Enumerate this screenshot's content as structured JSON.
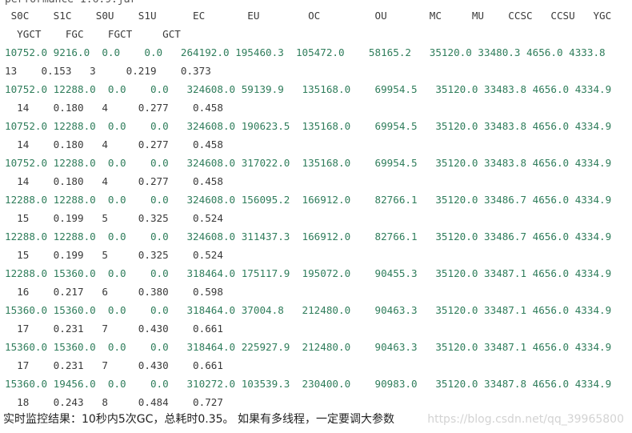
{
  "cmdline": "performance 1.6.9.jar",
  "header_row1": " S0C    S1C    S0U    S1U      EC       EU        OC         OU       MC     MU    CCSC   CCSU   YGC",
  "header_row2": "  YGCT    FGC    FGCT     GCT",
  "rows": [
    {
      "a": "10752.0 9216.0  0.0    0.0   264192.0 195460.3  105472.0    58165.2   35120.0 33480.3 4656.0 4333.8",
      "b": "13    0.153   3     0.219    0.373"
    },
    {
      "a": "10752.0 12288.0  0.0    0.0   324608.0 59139.9   135168.0    69954.5   35120.0 33483.8 4656.0 4334.9",
      "b": "  14    0.180   4     0.277    0.458"
    },
    {
      "a": "10752.0 12288.0  0.0    0.0   324608.0 190623.5  135168.0    69954.5   35120.0 33483.8 4656.0 4334.9",
      "b": "  14    0.180   4     0.277    0.458"
    },
    {
      "a": "10752.0 12288.0  0.0    0.0   324608.0 317022.0  135168.0    69954.5   35120.0 33483.8 4656.0 4334.9",
      "b": "  14    0.180   4     0.277    0.458"
    },
    {
      "a": "12288.0 12288.0  0.0    0.0   324608.0 156095.2  166912.0    82766.1   35120.0 33486.7 4656.0 4334.9",
      "b": "  15    0.199   5     0.325    0.524"
    },
    {
      "a": "12288.0 12288.0  0.0    0.0   324608.0 311437.3  166912.0    82766.1   35120.0 33486.7 4656.0 4334.9",
      "b": "  15    0.199   5     0.325    0.524"
    },
    {
      "a": "12288.0 15360.0  0.0    0.0   318464.0 175117.9  195072.0    90455.3   35120.0 33487.1 4656.0 4334.9",
      "b": "  16    0.217   6     0.380    0.598"
    },
    {
      "a": "15360.0 15360.0  0.0    0.0   318464.0 37004.8   212480.0    90463.3   35120.0 33487.1 4656.0 4334.9",
      "b": "  17    0.231   7     0.430    0.661"
    },
    {
      "a": "15360.0 15360.0  0.0    0.0   318464.0 225927.9  212480.0    90463.3   35120.0 33487.1 4656.0 4334.9",
      "b": "  17    0.231   7     0.430    0.661"
    },
    {
      "a": "15360.0 19456.0  0.0    0.0   310272.0 103539.3  230400.0    90983.0   35120.0 33487.8 4656.0 4334.9",
      "b": "  18    0.243   8     0.484    0.727"
    }
  ],
  "footer_text": "实时监控结果：10秒内5次GC，总耗时0.35。 如果有多线程，一定要调大参数",
  "watermark": "https://blog.csdn.net/qq_39965800",
  "colors": {
    "number": "#2f7d5b",
    "header": "#3a3a3a",
    "watermark": "#d3d3d3"
  }
}
